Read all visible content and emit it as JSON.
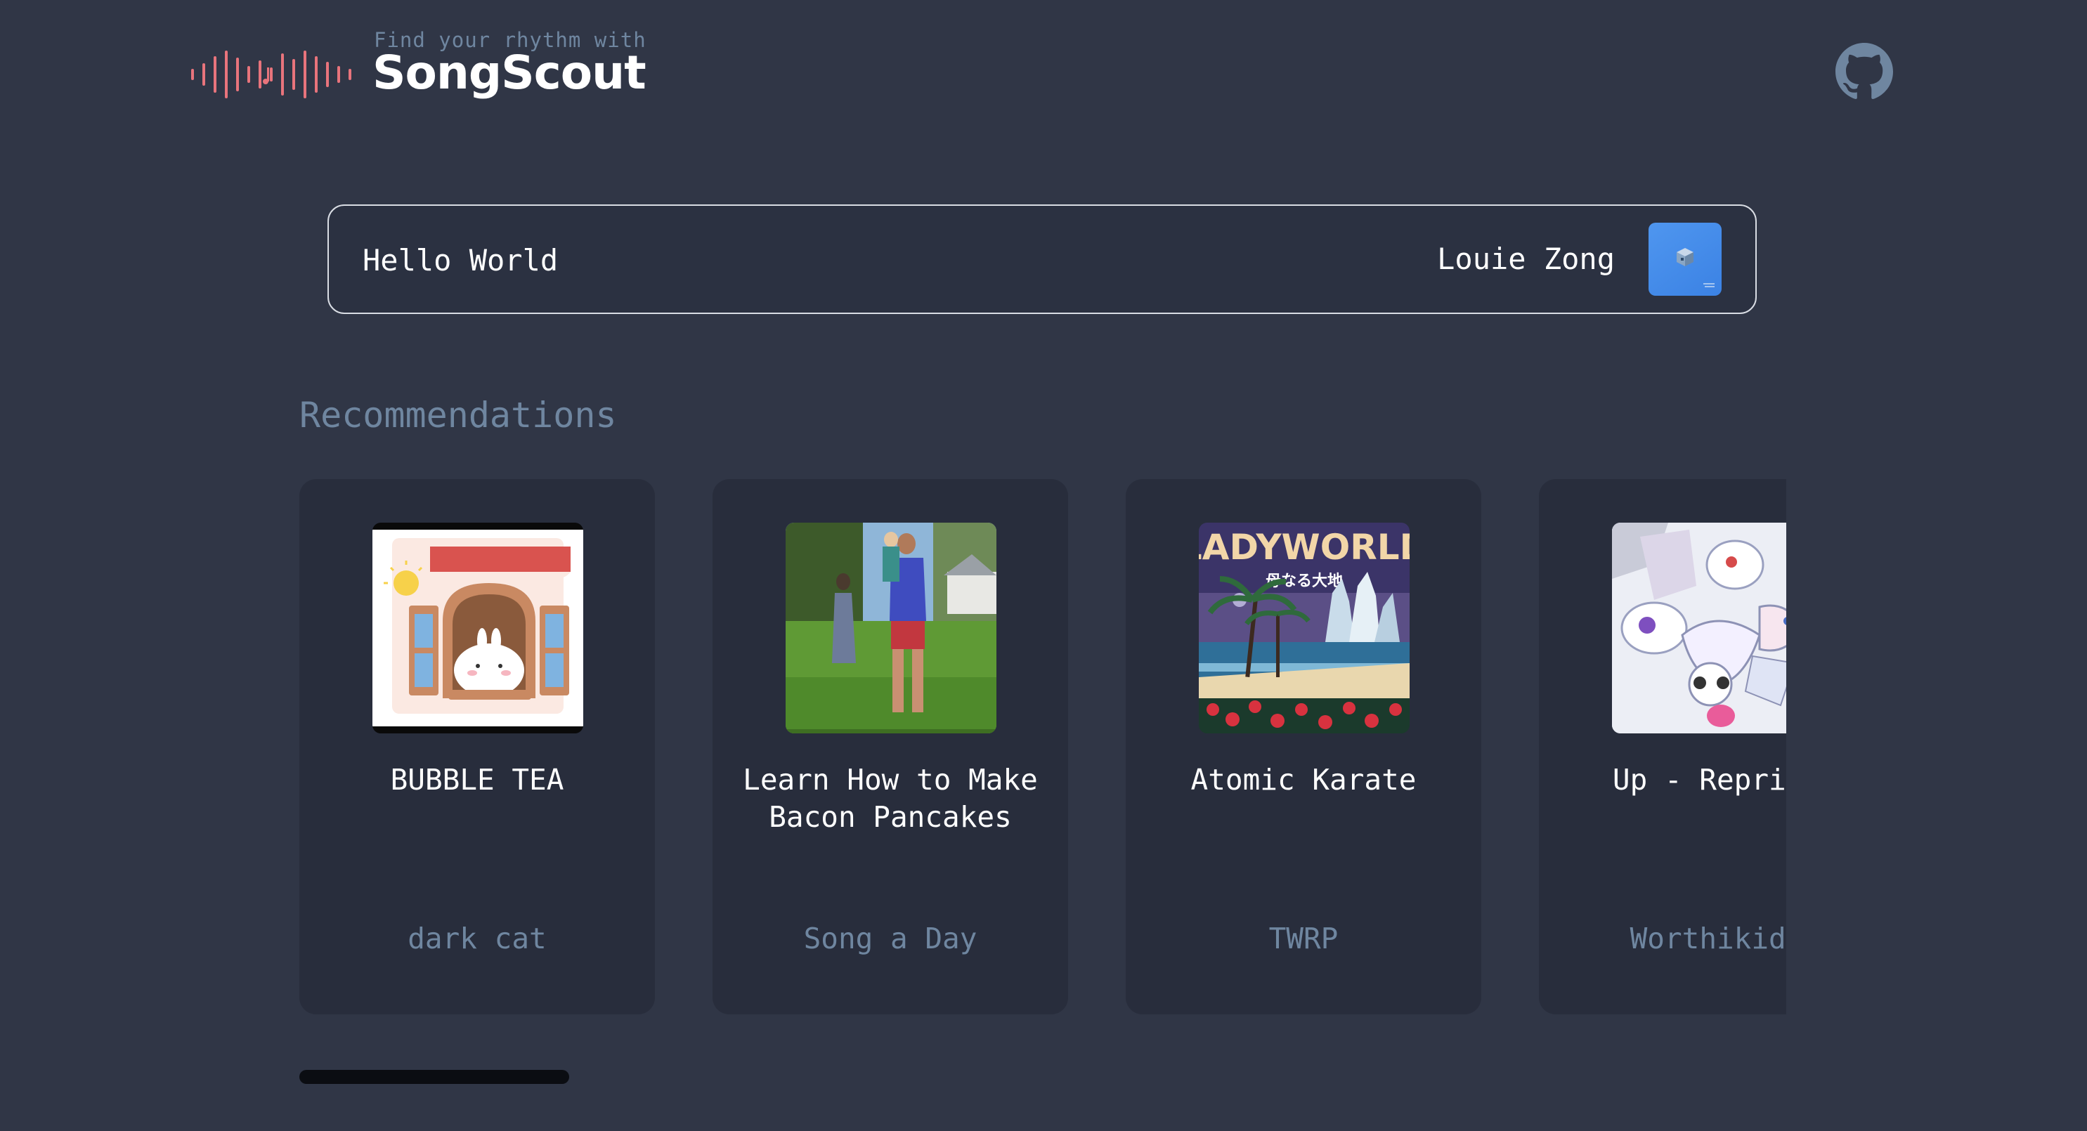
{
  "header": {
    "tagline": "Find your rhythm with",
    "brand": "SongScout",
    "accent_color": "#e8747c",
    "logo_icon": "soundwave-icon",
    "github_icon": "github-icon"
  },
  "now_playing": {
    "title": "Hello World",
    "artist": "Louie Zong"
  },
  "recommendations": {
    "heading": "Recommendations",
    "cards": [
      {
        "title": "BUBBLE TEA",
        "artist": "dark cat"
      },
      {
        "title": "Learn How to Make Bacon Pancakes",
        "artist": "Song a Day"
      },
      {
        "title": "Atomic Karate",
        "artist": "TWRP"
      },
      {
        "title": "Up - Reprise",
        "artist": "Worthikids"
      }
    ],
    "album_art_texts": {
      "ladyworld_title": "LADYWORLD",
      "ladyworld_subtitle": "母なる大地"
    }
  }
}
